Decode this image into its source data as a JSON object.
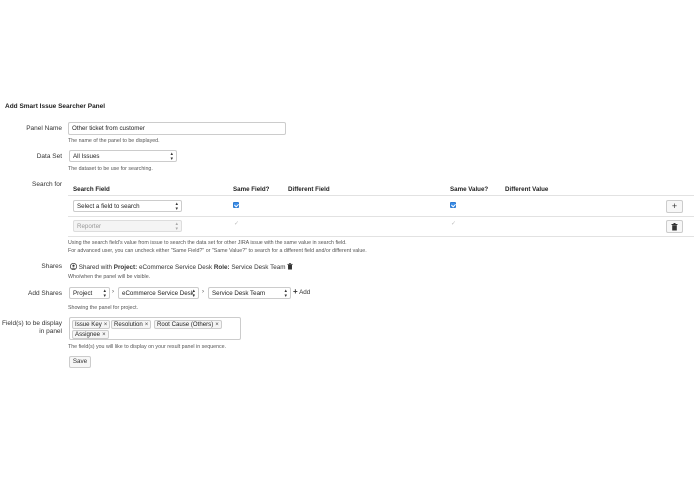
{
  "title": "Add Smart Issue Searcher Panel",
  "panel_name": {
    "label": "Panel Name",
    "value": "Other ticket from customer",
    "help": "The name of the panel to be displayed."
  },
  "data_set": {
    "label": "Data Set",
    "value": "All Issues",
    "help": "The dataset to be use for searching."
  },
  "search_for": {
    "label": "Search for",
    "headers": {
      "search_field": "Search Field",
      "same_field": "Same Field?",
      "different_field": "Different Field",
      "same_value": "Same Value?",
      "different_value": "Different Value"
    },
    "rows": [
      {
        "field": "Select a field to search",
        "same_field": true,
        "same_value": true,
        "disabled": false,
        "action": "add"
      },
      {
        "field": "Reporter",
        "same_field": true,
        "same_value": true,
        "disabled": true,
        "action": "delete"
      }
    ],
    "help_line1": "Using the search field's value from issue to search the data set for other JIRA issue with the same value in search field.",
    "help_line2": "For advanced user, you can uncheck either \"Same Field?\" or \"Same Value?\" to search for a different field and/or different value."
  },
  "shares": {
    "label": "Shares",
    "prefix": "Shared with",
    "project_key": "Project:",
    "project_value": "eCommerce Service Desk",
    "role_key": "Role:",
    "role_value": "Service Desk Team",
    "help": "Who/when the panel will be visible."
  },
  "add_shares": {
    "label": "Add Shares",
    "type": "Project",
    "project": "eCommerce Service Desk",
    "role": "Service Desk Team",
    "separator": "›",
    "add_label": "Add",
    "help": "Showing the panel for project."
  },
  "display_fields": {
    "label_line1": "Field(s) to be display",
    "label_line2": "in panel",
    "tags": [
      "Issue Key",
      "Resolution",
      "Root Cause (Others)",
      "Assignee"
    ],
    "help": "The field(s) you will like to display on your result panel in sequence."
  },
  "save_label": "Save",
  "icons": {
    "add": "plus-icon",
    "delete": "trash-icon",
    "share": "user-group-icon",
    "remove_share": "trash-icon",
    "tag_remove": "close-icon"
  },
  "colors": {
    "checkbox": "#3b8eea"
  }
}
